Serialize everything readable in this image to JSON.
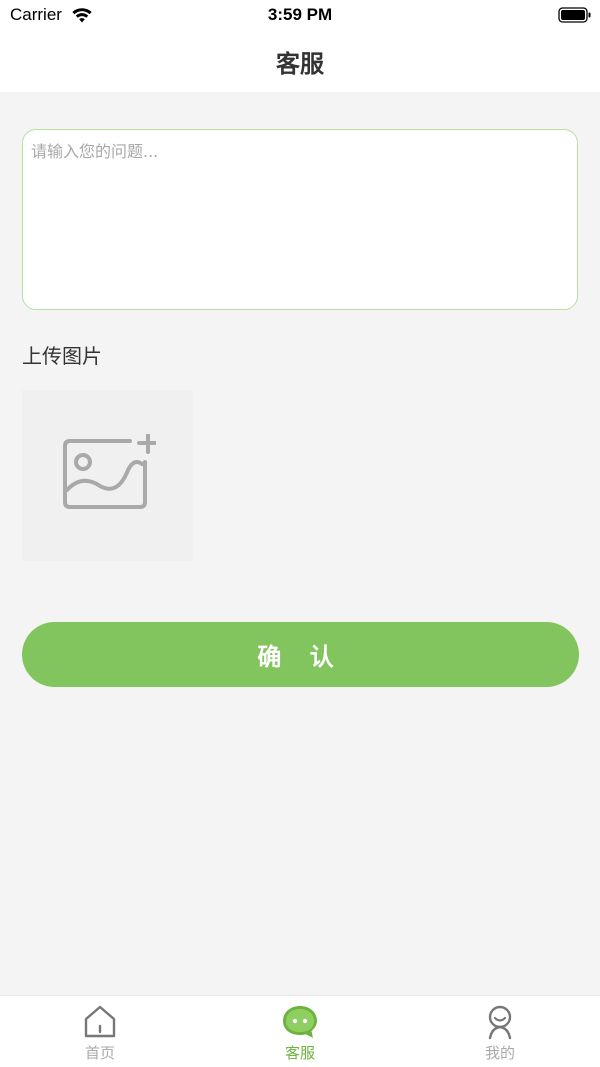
{
  "status_bar": {
    "carrier": "Carrier",
    "time": "3:59 PM",
    "wifi_icon": "wifi-icon",
    "battery_icon": "battery-icon"
  },
  "header": {
    "title": "客服"
  },
  "form": {
    "question_placeholder": "请输入您的问题...",
    "question_value": "",
    "upload_label": "上传图片",
    "upload_icon": "add-image-icon",
    "confirm_label": "确 认"
  },
  "tab_bar": {
    "active_color": "#6db33f",
    "inactive_color": "#aaaaaa",
    "tabs": [
      {
        "label": "首页",
        "icon": "home-icon",
        "active": false
      },
      {
        "label": "客服",
        "icon": "chat-icon",
        "active": true
      },
      {
        "label": "我的",
        "icon": "profile-icon",
        "active": false
      }
    ]
  },
  "colors": {
    "accent": "#82c45d",
    "background": "#f4f4f4",
    "input_border": "#b7df9e"
  }
}
